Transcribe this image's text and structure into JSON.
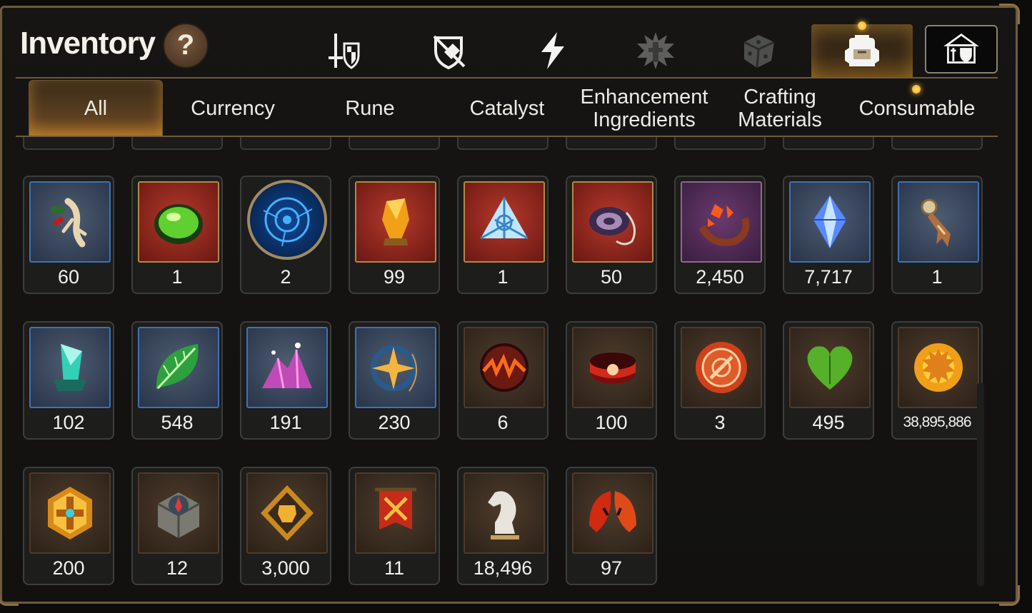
{
  "header": {
    "title": "Inventory",
    "help_label": "?"
  },
  "category_icons": [
    {
      "name": "sword-shield-icon"
    },
    {
      "name": "shield-slash-icon"
    },
    {
      "name": "lightning-icon"
    },
    {
      "name": "spiked-emblem-icon"
    },
    {
      "name": "dice-icon"
    },
    {
      "name": "backpack-icon",
      "active": true
    },
    {
      "name": "castle-shield-icon"
    }
  ],
  "tabs": [
    {
      "label": "All",
      "active": true
    },
    {
      "label": "Currency"
    },
    {
      "label": "Rune"
    },
    {
      "label": "Catalyst"
    },
    {
      "label": "Enhancement Ingredients"
    },
    {
      "label": "Crafting Materials"
    },
    {
      "label": "Consumable"
    }
  ],
  "items": [
    {
      "icon": "ginseng-root-icon",
      "frame": "blue",
      "count": "60"
    },
    {
      "icon": "green-gem-icon",
      "frame": "red",
      "count": "1"
    },
    {
      "icon": "blue-rune-orb-icon",
      "frame": "circle",
      "count": "2"
    },
    {
      "icon": "amber-crystal-icon",
      "frame": "red",
      "count": "99"
    },
    {
      "icon": "triangle-crystal-icon",
      "frame": "red",
      "count": "1"
    },
    {
      "icon": "pendant-ring-icon",
      "frame": "red",
      "count": "50"
    },
    {
      "icon": "orange-ring-icon",
      "frame": "purple",
      "count": "2,450"
    },
    {
      "icon": "blue-diamond-icon",
      "frame": "blue",
      "count": "7,717"
    },
    {
      "icon": "bookmark-sigil-icon",
      "frame": "blue",
      "count": "1"
    },
    {
      "icon": "teal-shard-icon",
      "frame": "blue",
      "count": "102"
    },
    {
      "icon": "green-leaf-icon",
      "frame": "blue",
      "count": "548"
    },
    {
      "icon": "pink-crystal-pile-icon",
      "frame": "blue",
      "count": "191"
    },
    {
      "icon": "star-amulet-icon",
      "frame": "blue",
      "count": "230"
    },
    {
      "icon": "fire-orb-icon",
      "frame": "brown",
      "count": "6"
    },
    {
      "icon": "red-bracelet-icon",
      "frame": "brown",
      "count": "100"
    },
    {
      "icon": "red-badge-icon",
      "frame": "brown",
      "count": "3"
    },
    {
      "icon": "green-heart-icon",
      "frame": "brown",
      "count": "495"
    },
    {
      "icon": "sun-coin-icon",
      "frame": "brown",
      "count": "38,895,886",
      "small": true
    },
    {
      "icon": "gold-medal-icon",
      "frame": "brown",
      "count": "200"
    },
    {
      "icon": "stone-compass-icon",
      "frame": "brown",
      "count": "12"
    },
    {
      "icon": "fist-emblem-icon",
      "frame": "brown",
      "count": "3,000"
    },
    {
      "icon": "war-banner-icon",
      "frame": "brown",
      "count": "11"
    },
    {
      "icon": "chess-knight-icon",
      "frame": "brown",
      "count": "18,496"
    },
    {
      "icon": "red-leaf-icon",
      "frame": "brown",
      "count": "97"
    }
  ],
  "colors": {
    "accent_gold": "#d9a441",
    "frame_border": "#6e5a3a",
    "text": "#f2f1ec"
  }
}
